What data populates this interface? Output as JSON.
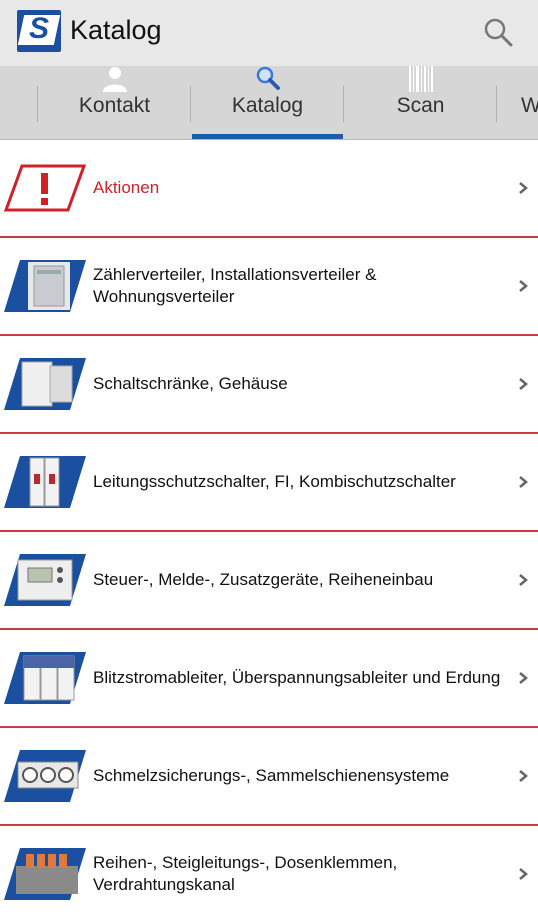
{
  "app": {
    "logo_letter": "S",
    "title": "Katalog",
    "brand_color": "#1b4fa0",
    "accent_red": "#d02127"
  },
  "tabs": [
    {
      "label": "Kontakt",
      "icon": "person-icon",
      "selected": false
    },
    {
      "label": "Katalog",
      "icon": "magnifier-icon",
      "selected": true
    },
    {
      "label": "Scan",
      "icon": "barcode-icon",
      "selected": false
    },
    {
      "label": "W",
      "icon": "",
      "selected": false
    }
  ],
  "list": [
    {
      "label": "Aktionen",
      "icon": "warning-exclamation-icon",
      "highlight": true
    },
    {
      "label": "Zählerverteiler, Installationsverteiler & Wohnungsverteiler",
      "icon": "distribution-board-thumb",
      "highlight": false
    },
    {
      "label": "Schaltschränke, Gehäuse",
      "icon": "cabinet-thumb",
      "highlight": false
    },
    {
      "label": "Leitungsschutzschalter, FI, Kombischutzschalter",
      "icon": "circuit-breaker-thumb",
      "highlight": false
    },
    {
      "label": "Steuer-, Melde-, Zusatzgeräte, Reiheneinbau",
      "icon": "control-device-thumb",
      "highlight": false
    },
    {
      "label": "Blitzstromableiter, Überspannungsableiter und Erdung",
      "icon": "surge-protector-thumb",
      "highlight": false
    },
    {
      "label": "Schmelzsicherungs-, Sammelschienensysteme",
      "icon": "fuse-system-thumb",
      "highlight": false
    },
    {
      "label": "Reihen-, Steigleitungs-, Dosenklemmen, Verdrahtungskanal",
      "icon": "terminal-block-thumb",
      "highlight": false
    }
  ]
}
